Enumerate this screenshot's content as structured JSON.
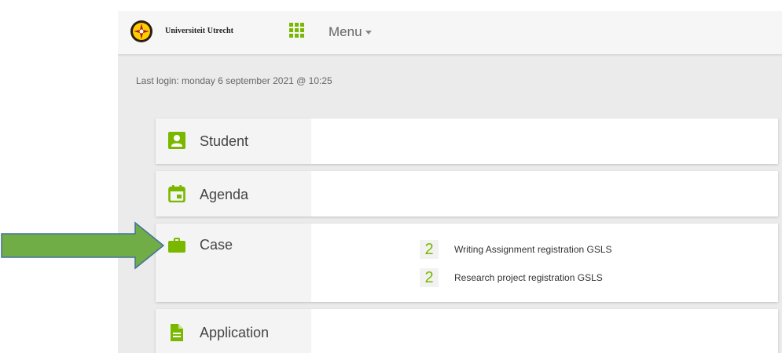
{
  "header": {
    "brand": "Universiteit Utrecht",
    "menu_label": "Menu"
  },
  "last_login": "Last login: monday 6 september 2021 @ 10:25",
  "cards": [
    {
      "title": "Student",
      "icon": "user-icon"
    },
    {
      "title": "Agenda",
      "icon": "calendar-icon"
    },
    {
      "title": "Case",
      "icon": "briefcase-icon",
      "items": [
        {
          "count": "2",
          "label": "Writing Assignment registration GSLS"
        },
        {
          "count": "2",
          "label": "Research project registration GSLS"
        }
      ]
    },
    {
      "title": "Application",
      "icon": "document-icon"
    }
  ],
  "colors": {
    "accent_green": "#7ab800",
    "arrow_green": "#70ad47",
    "arrow_outline": "#41719c",
    "brand_red": "#c00000",
    "page_background": "#ebebeb"
  }
}
